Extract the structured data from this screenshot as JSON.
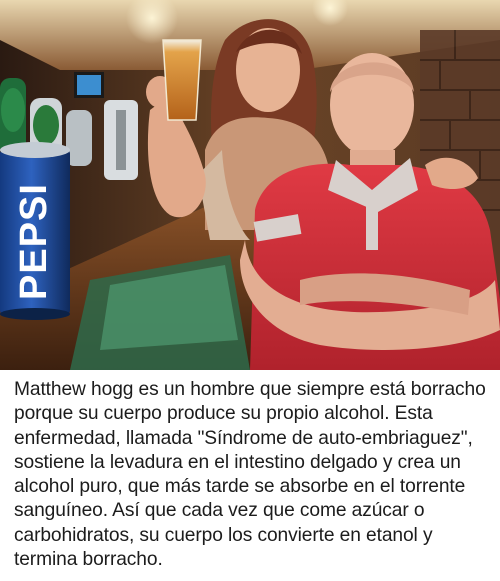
{
  "photo": {
    "description_alt": "",
    "brand_text": "PEPSI",
    "colors": {
      "pub_wall": "#5a3a24",
      "bar_wood": "#6b3e22",
      "shirt_red": "#d62f3a",
      "beer": "#c9791f",
      "pepsi_blue": "#1f4fa6"
    }
  },
  "caption": {
    "text": "Matthew hogg es un hombre que siempre está borracho porque su cuerpo produce su propio alcohol. Esta enfermedad, llamada \"Síndrome de auto-embriaguez\", sostiene la levadura en el intestino delgado y crea un alcohol puro, que más tarde se absorbe en el torrente sanguíneo. Así que cada vez que come azúcar o carbohidratos, su cuerpo los convierte en etanol y termina borracho."
  }
}
